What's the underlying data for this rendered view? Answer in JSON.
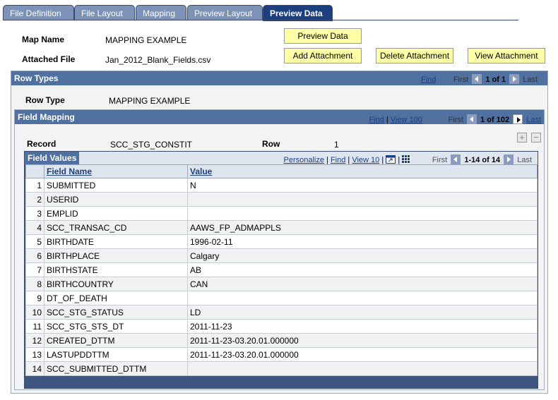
{
  "tabs": [
    {
      "label": "File Definition"
    },
    {
      "label": "File Layout"
    },
    {
      "label": "Mapping"
    },
    {
      "label": "Preview Layout"
    },
    {
      "label": "Preview Data"
    }
  ],
  "header": {
    "map_name_label": "Map Name",
    "map_name_value": "MAPPING EXAMPLE",
    "attached_file_label": "Attached File",
    "attached_file_value": "Jan_2012_Blank_Fields.csv",
    "preview_data_button": "Preview Data",
    "add_attachment_button": "Add Attachment",
    "delete_attachment_button": "Delete Attachment",
    "view_attachment_button": "View Attachment"
  },
  "row_types": {
    "title": "Row Types",
    "find": "Find",
    "first": "First",
    "count": "1 of 1",
    "last": "Last",
    "row_type_label": "Row Type",
    "row_type_value": "MAPPING EXAMPLE"
  },
  "field_mapping": {
    "title": "Field Mapping",
    "find": "Find",
    "view": "View 100",
    "first": "First",
    "count": "1 of 102",
    "last": "Last",
    "record_label": "Record",
    "record_value": "SCC_STG_CONSTIT",
    "row_label": "Row",
    "row_value": "1",
    "add_symbol": "+",
    "remove_symbol": "−"
  },
  "field_values": {
    "title": "Field Values",
    "personalize": "Personalize",
    "find": "Find",
    "view": "View 10",
    "first": "First",
    "count": "1-14 of 14",
    "last": "Last",
    "columns": [
      "Field Name",
      "Value"
    ],
    "rows": [
      {
        "num": "1",
        "field": "SUBMITTED",
        "value": "N"
      },
      {
        "num": "2",
        "field": "USERID",
        "value": ""
      },
      {
        "num": "3",
        "field": "EMPLID",
        "value": ""
      },
      {
        "num": "4",
        "field": "SCC_TRANSAC_CD",
        "value": "AAWS_FP_ADMAPPLS"
      },
      {
        "num": "5",
        "field": "BIRTHDATE",
        "value": "1996-02-11"
      },
      {
        "num": "6",
        "field": "BIRTHPLACE",
        "value": "Calgary"
      },
      {
        "num": "7",
        "field": "BIRTHSTATE",
        "value": "AB"
      },
      {
        "num": "8",
        "field": "BIRTHCOUNTRY",
        "value": "CAN"
      },
      {
        "num": "9",
        "field": "DT_OF_DEATH",
        "value": ""
      },
      {
        "num": "10",
        "field": "SCC_STG_STATUS",
        "value": "LD"
      },
      {
        "num": "11",
        "field": "SCC_STG_STS_DT",
        "value": "2011-11-23"
      },
      {
        "num": "12",
        "field": "CREATED_DTTM",
        "value": "2011-11-23-03.20.01.000000"
      },
      {
        "num": "13",
        "field": "LASTUPDDTTM",
        "value": "2011-11-23-03.20.01.000000"
      },
      {
        "num": "14",
        "field": "SCC_SUBMITTED_DTTM",
        "value": ""
      }
    ]
  },
  "colors": {
    "tab_inactive": "#7d92b7",
    "tab_active": "#1c3f7f",
    "group_bar": "#5070a0",
    "button_bg": "#ffffa8"
  }
}
